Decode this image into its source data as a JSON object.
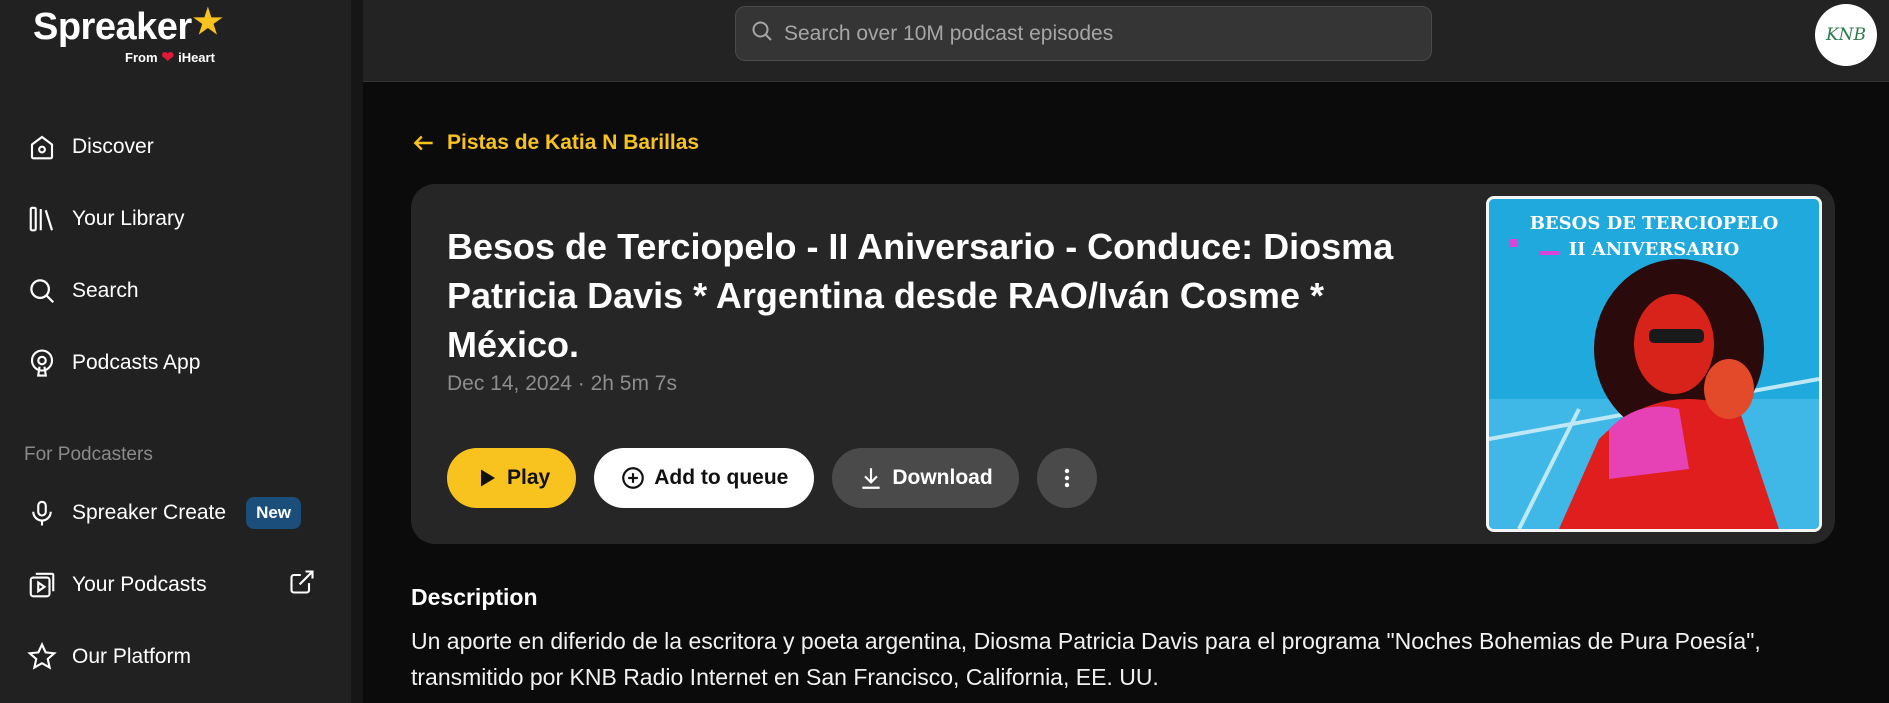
{
  "app": {
    "brand": "Spreaker",
    "brand_sub_from": "From",
    "brand_sub_partner": "iHeart",
    "accent_color": "#f8c31e"
  },
  "sidebar": {
    "items": [
      {
        "label": "Discover",
        "icon": "home-icon"
      },
      {
        "label": "Your Library",
        "icon": "library-icon"
      },
      {
        "label": "Search",
        "icon": "search-icon"
      },
      {
        "label": "Podcasts App",
        "icon": "podcast-app-icon"
      }
    ],
    "section_label": "For Podcasters",
    "podcaster_items": [
      {
        "label": "Spreaker Create",
        "icon": "microphone-icon",
        "badge": "New"
      },
      {
        "label": "Your Podcasts",
        "icon": "podcast-play-icon",
        "trailing_icon": "external-link-icon"
      },
      {
        "label": "Our Platform",
        "icon": "star-outline-icon"
      }
    ]
  },
  "header": {
    "search_placeholder": "Search over 10M podcast episodes",
    "avatar_label": "KNB"
  },
  "episode": {
    "back_label": "Pistas de Katia N Barillas",
    "title": "Besos de Terciopelo - II Aniversario - Conduce: Diosma Patricia Davis * Argentina desde RAO/Iván Cosme * México.",
    "meta": "Dec 14, 2024 · 2h 5m 7s",
    "buttons": {
      "play": "Play",
      "queue": "Add to queue",
      "download": "Download"
    },
    "cover_text_line1": "BESOS DE TERCIOPELO",
    "cover_text_line2": "II ANIVERSARIO"
  },
  "description": {
    "heading": "Description",
    "text": "Un aporte en diferido de la escritora y poeta argentina, Diosma Patricia Davis para el programa \"Noches Bohemias de Pura Poesía\", transmitido por KNB Radio Internet en San Francisco, California, EE. UU."
  }
}
